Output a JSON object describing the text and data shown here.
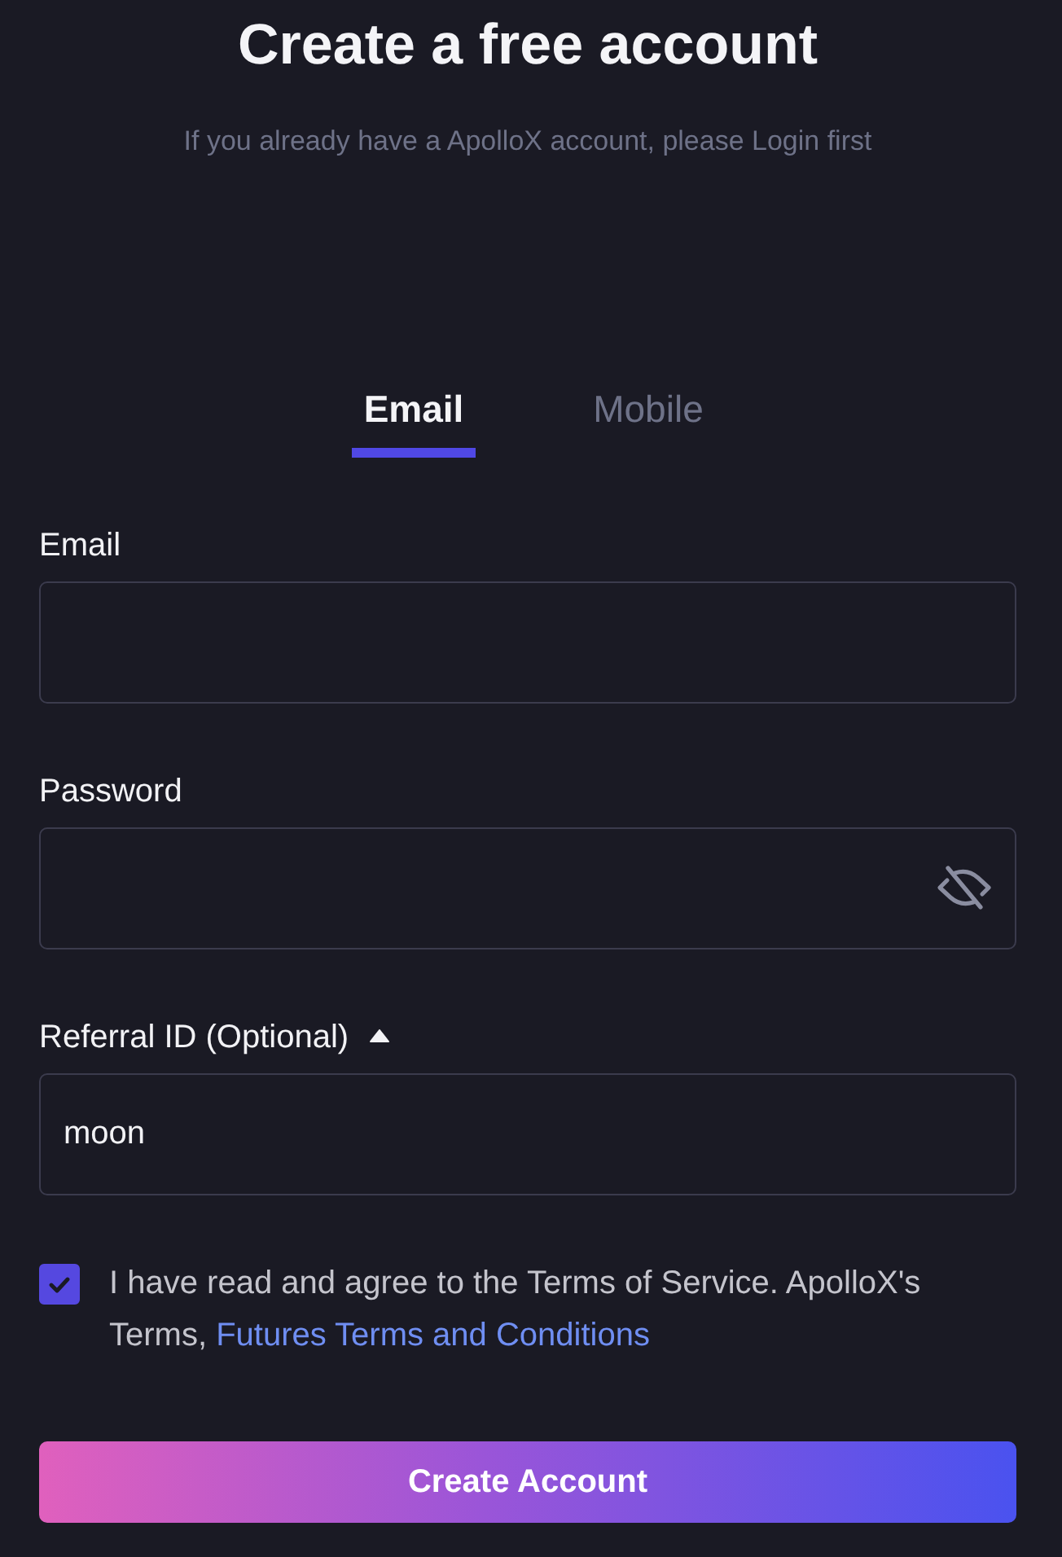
{
  "header": {
    "title": "Create a free account",
    "subtitle": "If you already have a ApolloX account, please Login first"
  },
  "tabs": [
    {
      "label": "Email",
      "selected": true
    },
    {
      "label": "Mobile",
      "selected": false
    }
  ],
  "fields": [
    {
      "kind": "text",
      "label": "Email"
    },
    {
      "kind": "password",
      "label": "Password"
    },
    {
      "kind": "collapsible",
      "label": "Referral ID (Optional)",
      "expanded": true,
      "value": "moon"
    }
  ],
  "agreement": {
    "checked": true,
    "text": "I have read and agree to the Terms of Service. ApolloX's Terms,",
    "link": "Futures Terms and Conditions"
  },
  "submit": {
    "label": "Create Account"
  }
}
